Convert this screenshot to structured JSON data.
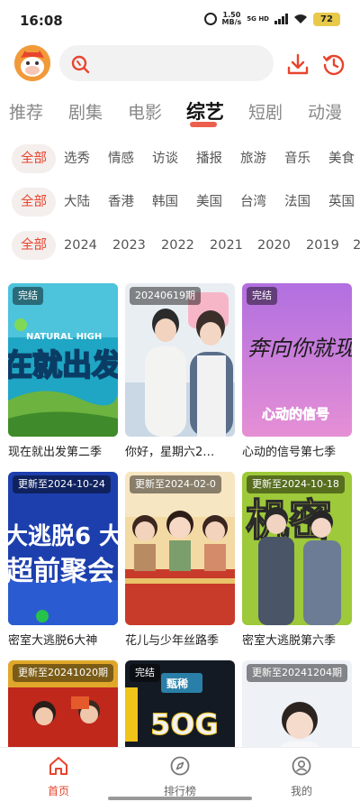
{
  "status_bar": {
    "time": "16:08",
    "speed_value": "1.50",
    "speed_unit": "MB/s",
    "signal_label": "5G HD",
    "battery": "72"
  },
  "header": {
    "search_placeholder": ""
  },
  "tabs": [
    {
      "label": "推荐",
      "active": false
    },
    {
      "label": "剧集",
      "active": false
    },
    {
      "label": "电影",
      "active": false
    },
    {
      "label": "综艺",
      "active": true
    },
    {
      "label": "短剧",
      "active": false
    },
    {
      "label": "动漫",
      "active": false
    }
  ],
  "filters": {
    "type": [
      "全部",
      "选秀",
      "情感",
      "访谈",
      "播报",
      "旅游",
      "音乐",
      "美食"
    ],
    "region": [
      "全部",
      "大陆",
      "香港",
      "韩国",
      "美国",
      "台湾",
      "法国",
      "英国"
    ],
    "year": [
      "全部",
      "2024",
      "2023",
      "2022",
      "2021",
      "2020",
      "2019",
      "2"
    ]
  },
  "cards": [
    {
      "title": "现在就出发第二季",
      "badge": "完结"
    },
    {
      "title": "你好，星期六2…",
      "badge": "20240619期"
    },
    {
      "title": "心动的信号第七季",
      "badge": "完结"
    },
    {
      "title": "密室大逃脱6大神",
      "badge": "更新至2024-10-24"
    },
    {
      "title": "花儿与少年丝路季",
      "badge": "更新至2024-02-0"
    },
    {
      "title": "密室大逃脱第六季",
      "badge": "更新至2024-10-18"
    },
    {
      "title": "",
      "badge": "更新至20241020期"
    },
    {
      "title": "",
      "badge": "完结"
    },
    {
      "title": "",
      "badge": "更新至20241204期"
    }
  ],
  "poster_text": {
    "natural_high": "NATURAL HIGH",
    "c1_big": "在就出发",
    "c3_script": "奔向你就现在",
    "c3_logo": "心动的信号",
    "c4_line1": "大逃脱6 大",
    "c4_line2": "超前聚会",
    "c6_big": "机密",
    "c8_logo1": "甄稀",
    "c8_logo2": "5OG"
  },
  "bottom_nav": [
    {
      "label": "首页",
      "icon": "home-icon",
      "active": true
    },
    {
      "label": "排行榜",
      "icon": "compass-icon",
      "active": false
    },
    {
      "label": "我的",
      "icon": "profile-icon",
      "active": false
    }
  ],
  "colors": {
    "accent": "#e8442e",
    "active_chip_bg": "#f4eeec",
    "search_bg": "#f2f2f2"
  }
}
